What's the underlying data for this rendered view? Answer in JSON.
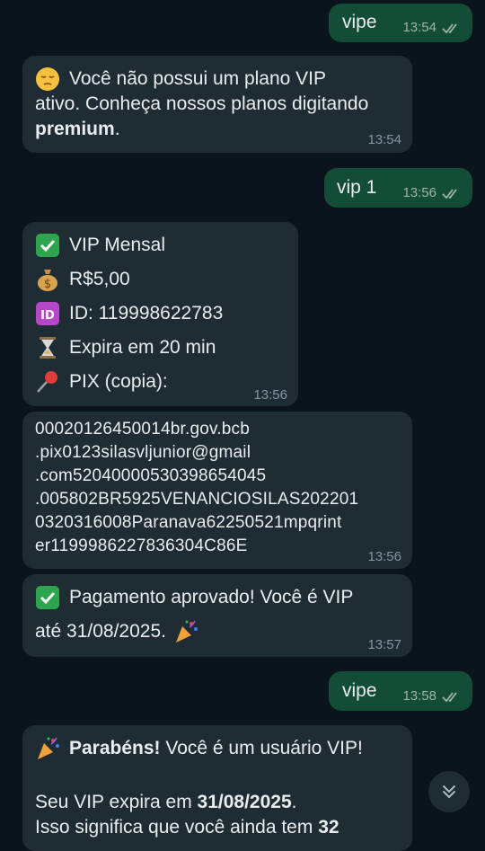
{
  "messages": {
    "m1": {
      "text": "vipe",
      "time": "13:54"
    },
    "m2": {
      "line1": "Você não possui um plano VIP",
      "line2": "ativo. Conheça nossos planos digitando",
      "bold": "premium",
      "after": ".",
      "time": "13:54"
    },
    "m3": {
      "text": "vip 1",
      "time": "13:56"
    },
    "m4": {
      "plan": "VIP Mensal",
      "price": "R$5,00",
      "id": "ID: 119998622783",
      "expire": "Expira em 20 min",
      "pix": "PIX (copia):",
      "time": "13:56"
    },
    "m5": {
      "lines": [
        "00020126450014br.gov.bcb",
        ".pix0123silasvljunior@gmail",
        ".com5204000053039865404​5",
        ".005802BR5925VENANCIOSILAS202201",
        "0320316008Paranava62250521mpqrint",
        "er1199986227836304C86E"
      ],
      "time": "13:56"
    },
    "m6": {
      "line1": "Pagamento aprovado! Você é VIP",
      "line2": "até 31/08/2025.",
      "time": "13:57"
    },
    "m7": {
      "text": "vipe",
      "time": "13:58"
    },
    "m8": {
      "bold1": "Parabéns!",
      "rest1": " Você é um usuário VIP!",
      "line2a": "Seu VIP expira em ",
      "line2b": "31/08/2025",
      "line2c": ".",
      "line3a": "Isso significa que você ainda tem ",
      "line3b": "32"
    }
  },
  "icons": [
    "check-mark-emoji",
    "money-bag-emoji",
    "id-emoji",
    "hourglass-emoji",
    "pushpin-emoji",
    "party-popper-emoji",
    "pensive-face-emoji",
    "double-check-icon",
    "chevron-double-down-icon"
  ],
  "colors": {
    "background": "#0b141a",
    "outgoing": "#144d37",
    "incoming": "#202c33",
    "check": "#2ea44f"
  }
}
